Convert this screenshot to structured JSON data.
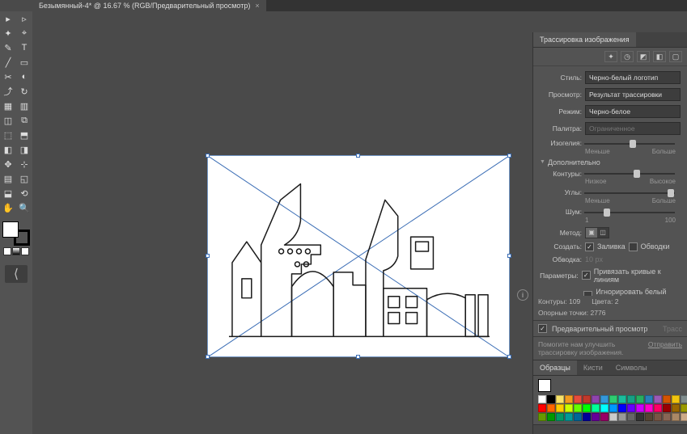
{
  "tab": {
    "title": "Безымянный-4* @ 16.67 % (RGB/Предварительный просмотр)",
    "close": "×"
  },
  "toolbar_icons": [
    "▸",
    "▹",
    "✦",
    "⌖",
    "✎",
    "T",
    "╱",
    "▭",
    "✂",
    "◐",
    "⤴",
    "↻",
    "▦",
    "▥",
    "◫",
    "⧉",
    "⬚",
    "⬒",
    "◧",
    "◨",
    "✥",
    "⊹",
    "▤",
    "◱",
    "⬓",
    "⟲",
    "✋",
    "🔍"
  ],
  "panels": {
    "trace": {
      "title": "Трассировка изображения",
      "style_label": "Стиль:",
      "style_value": "Черно-белый логотип",
      "view_label": "Просмотр:",
      "view_value": "Результат трассировки",
      "mode_label": "Режим:",
      "mode_value": "Черно-белое",
      "palette_label": "Палитра:",
      "palette_value": "Ограниченное",
      "threshold_label": "Изогелия:",
      "threshold_low": "Меньше",
      "threshold_high": "Больше",
      "advanced_title": "Дополнительно",
      "paths_label": "Контуры:",
      "paths_low": "Низкое",
      "paths_high": "Высокое",
      "corners_label": "Углы:",
      "corners_low": "Меньше",
      "corners_high": "Больше",
      "noise_label": "Шум:",
      "noise_low": "1",
      "noise_high": "100",
      "method_label": "Метод:",
      "create_label": "Создать:",
      "create_fill": "Заливка",
      "create_stroke": "Обводки",
      "stroke_label": "Обводка:",
      "stroke_value": "10 px",
      "options_label": "Параметры:",
      "opt_snap": "Привязать кривые к линиям",
      "opt_ignore": "Игнорировать белый цвет",
      "info_paths_label": "Контуры:",
      "info_paths_value": "109",
      "info_colors_label": "Цвета:",
      "info_colors_value": "2",
      "info_anchors_label": "Опорные точки:",
      "info_anchors_value": "2776",
      "preview_label": "Предварительный просмотр",
      "trace_btn": "Трасс",
      "help_text": "Помогите нам улучшить трассировку изображения.",
      "help_link": "Отправить"
    },
    "swatches": {
      "tabs": [
        "Образцы",
        "Кисти",
        "Символы"
      ],
      "colors": [
        "#ffffff",
        "#000000",
        "#f7e26b",
        "#f29c1f",
        "#e74c3c",
        "#c0392b",
        "#8e44ad",
        "#3498db",
        "#2ecc71",
        "#1abc9c",
        "#16a085",
        "#27ae60",
        "#2980b9",
        "#9b59b6",
        "#d35400",
        "#f1c40f",
        "#7f8c8d",
        "#ff0000",
        "#ff6600",
        "#ffcc00",
        "#ccff00",
        "#66ff00",
        "#00ff00",
        "#00ff99",
        "#00ffff",
        "#0099ff",
        "#0000ff",
        "#6600ff",
        "#cc00ff",
        "#ff00cc",
        "#ff0066",
        "#990000",
        "#996600",
        "#999900",
        "#669900",
        "#009900",
        "#009966",
        "#009999",
        "#006699",
        "#000099",
        "#660099",
        "#990066",
        "#cccccc",
        "#999999",
        "#666666",
        "#333333",
        "#554433",
        "#775544",
        "#886655",
        "#aa8866",
        "#ccaa88"
      ]
    }
  }
}
